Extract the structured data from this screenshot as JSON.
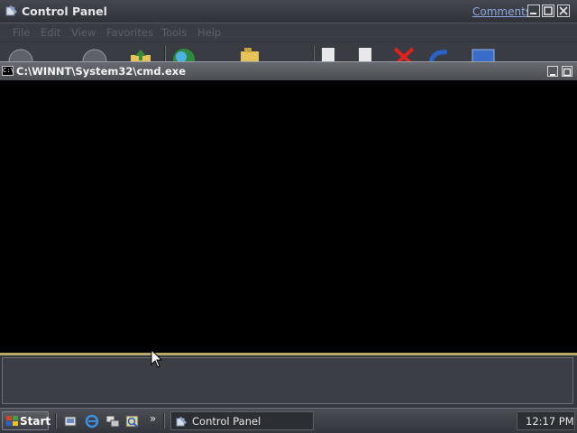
{
  "control_panel": {
    "title": "Control Panel",
    "comments_link": "Comments?",
    "menu": [
      "File",
      "Edit",
      "View",
      "Favorites",
      "Tools",
      "Help"
    ]
  },
  "cmd": {
    "icon_text": "C:\\",
    "title": "C:\\WINNT\\System32\\cmd.exe"
  },
  "taskbar": {
    "start_label": "Start",
    "more_label": "»",
    "task_control_panel": "Control Panel",
    "clock": "12:17 PM"
  },
  "icons": {
    "quick_launch": [
      "show-desktop-icon",
      "internet-explorer-icon",
      "network-icon",
      "search-icon"
    ]
  }
}
